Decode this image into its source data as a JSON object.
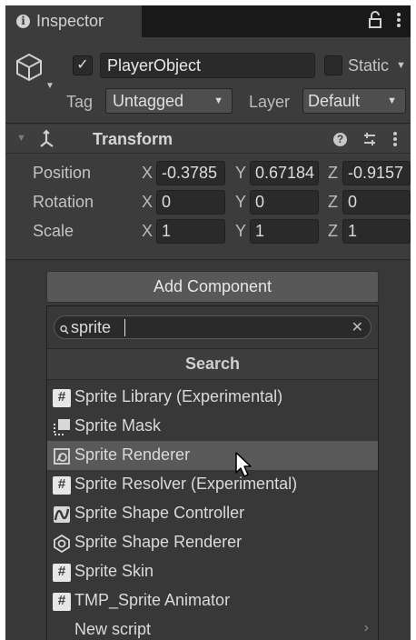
{
  "window": {
    "tab_title": "Inspector"
  },
  "object": {
    "name": "PlayerObject",
    "active": true,
    "static_label": "Static",
    "tag_label": "Tag",
    "tag_value": "Untagged",
    "layer_label": "Layer",
    "layer_value": "Default"
  },
  "transform": {
    "title": "Transform",
    "rows": [
      {
        "label": "Position",
        "x": "-0.3785",
        "y": "0.67184",
        "z": "-0.9157"
      },
      {
        "label": "Rotation",
        "x": "0",
        "y": "0",
        "z": "0"
      },
      {
        "label": "Scale",
        "x": "1",
        "y": "1",
        "z": "1"
      }
    ],
    "axes": {
      "x": "X",
      "y": "Y",
      "z": "Z"
    }
  },
  "add_component": {
    "button_label": "Add Component",
    "search_value": "sprite",
    "results_header": "Search",
    "results": [
      {
        "label": "Sprite Library (Experimental)",
        "icon": "script-icon"
      },
      {
        "label": "Sprite Mask",
        "icon": "sprite-mask-icon"
      },
      {
        "label": "Sprite Renderer",
        "icon": "sprite-renderer-icon",
        "selected": true
      },
      {
        "label": "Sprite Resolver (Experimental)",
        "icon": "script-icon"
      },
      {
        "label": "Sprite Shape Controller",
        "icon": "sprite-shape-controller-icon"
      },
      {
        "label": "Sprite Shape Renderer",
        "icon": "sprite-shape-renderer-icon"
      },
      {
        "label": "Sprite Skin",
        "icon": "script-icon"
      },
      {
        "label": "TMP_Sprite Animator",
        "icon": "script-icon"
      },
      {
        "label": "New script",
        "icon": "none",
        "has_submenu": true
      }
    ]
  },
  "colors": {
    "panel_bg": "#383838",
    "field_bg": "#2a2a2a",
    "selected_row": "#595959"
  }
}
